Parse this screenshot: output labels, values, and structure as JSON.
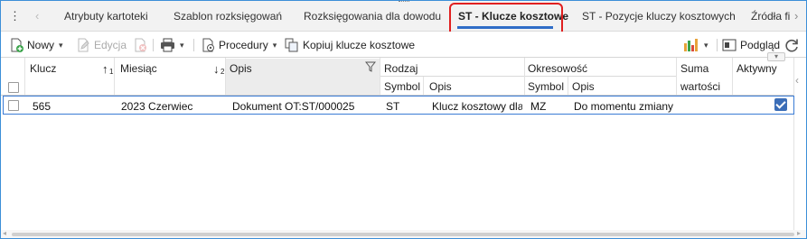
{
  "tabs": [
    {
      "label": "Atrybuty kartoteki"
    },
    {
      "label": "Szablon rozksięgowań"
    },
    {
      "label": "Rozksięgowania dla dowodu"
    },
    {
      "label": "ST - Klucze kosztowe",
      "active": true
    },
    {
      "label": "ST - Pozycje kluczy kosztowych"
    },
    {
      "label": "Źródła fi"
    }
  ],
  "toolbar": {
    "new_label": "Nowy",
    "edit_label": "Edycja",
    "procedures_label": "Procedury",
    "copy_label": "Kopiuj klucze kosztowe",
    "preview_label": "Podgląd"
  },
  "grid": {
    "headers": {
      "klucz": "Klucz",
      "miesiac": "Miesiąc",
      "opis": "Opis",
      "rodzaj": "Rodzaj",
      "rodzaj_symbol": "Symbol",
      "rodzaj_opis": "Opis",
      "okresowosc": "Okresowość",
      "okres_symbol": "Symbol",
      "okres_opis": "Opis",
      "suma": "Suma",
      "suma_wartosci": "wartości",
      "aktywny": "Aktywny",
      "sort_1": "1",
      "sort_2": "2"
    },
    "rows": [
      {
        "klucz": "565",
        "miesiac": "2023 Czerwiec",
        "opis": "Dokument OT:ST/000025",
        "rodzaj_symbol": "ST",
        "rodzaj_opis": "Klucz kosztowy dla ś",
        "okres_symbol": "MZ",
        "okres_opis": "Do momentu zmiany",
        "suma": "",
        "aktywny": true
      }
    ]
  },
  "colors": {
    "accent": "#2f6dc7",
    "highlight": "#e02020",
    "frame": "#3c8fd8",
    "green_icon": "#3aa34a",
    "chart_bars": [
      "#e8a33a",
      "#3aa34a",
      "#d94a3a"
    ]
  }
}
